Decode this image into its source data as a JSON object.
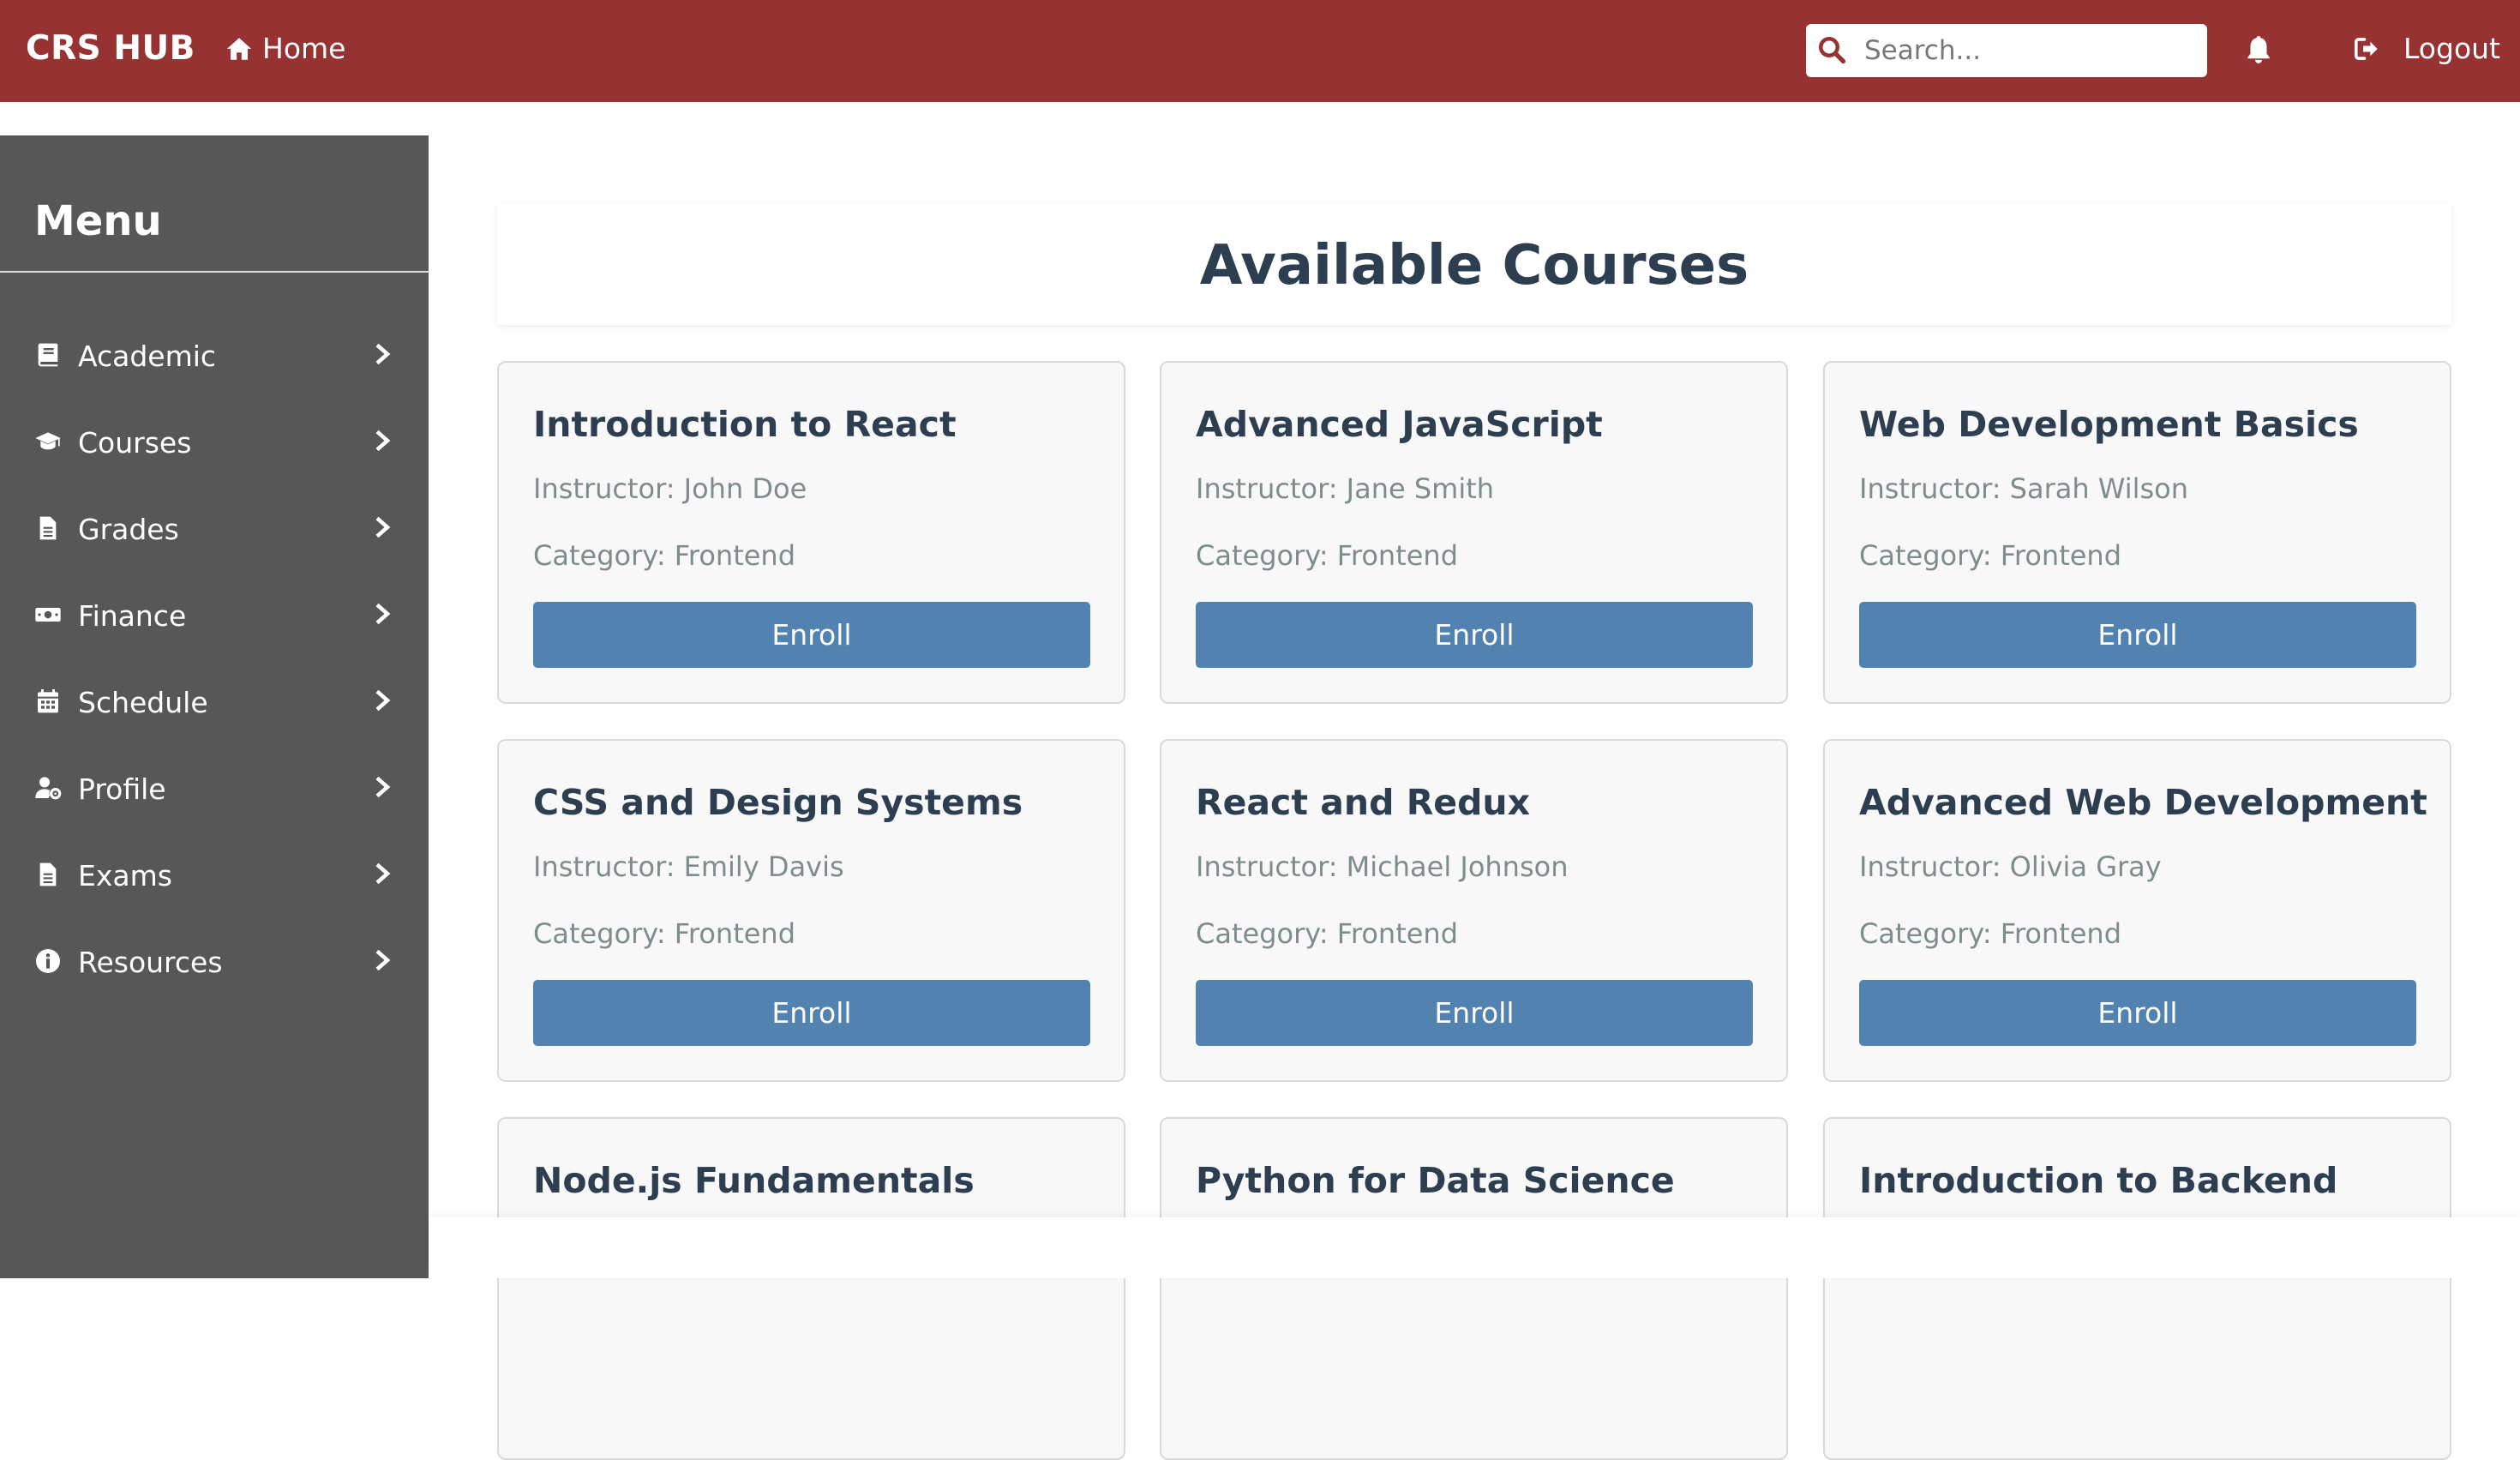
{
  "header": {
    "brand": "CRS HUB",
    "home_label": "Home",
    "search_placeholder": "Search...",
    "logout_label": "Logout"
  },
  "sidebar": {
    "title": "Menu",
    "items": [
      {
        "label": "Academic",
        "icon": "book-icon"
      },
      {
        "label": "Courses",
        "icon": "graduation-cap-icon"
      },
      {
        "label": "Grades",
        "icon": "document-icon"
      },
      {
        "label": "Finance",
        "icon": "money-icon"
      },
      {
        "label": "Schedule",
        "icon": "calendar-icon"
      },
      {
        "label": "Profile",
        "icon": "user-cog-icon"
      },
      {
        "label": "Exams",
        "icon": "document-icon"
      },
      {
        "label": "Resources",
        "icon": "info-icon"
      }
    ]
  },
  "main": {
    "title": "Available Courses",
    "enroll_label": "Enroll",
    "courses": [
      {
        "title": "Introduction to React",
        "instructor": "Instructor: John Doe",
        "category": "Category: Frontend"
      },
      {
        "title": "Advanced JavaScript",
        "instructor": "Instructor: Jane Smith",
        "category": "Category: Frontend"
      },
      {
        "title": "Web Development Basics",
        "instructor": "Instructor: Sarah Wilson",
        "category": "Category: Frontend"
      },
      {
        "title": "CSS and Design Systems",
        "instructor": "Instructor: Emily Davis",
        "category": "Category: Frontend"
      },
      {
        "title": "React and Redux",
        "instructor": "Instructor: Michael Johnson",
        "category": "Category: Frontend"
      },
      {
        "title": "Advanced Web Development",
        "instructor": "Instructor: Olivia Gray",
        "category": "Category: Frontend"
      },
      {
        "title": "Node.js Fundamentals",
        "instructor": "",
        "category": ""
      },
      {
        "title": "Python for Data Science",
        "instructor": "",
        "category": ""
      },
      {
        "title": "Introduction to Backend",
        "instructor": "",
        "category": ""
      }
    ]
  },
  "colors": {
    "header_bg": "#973232",
    "sidebar_bg": "#575757",
    "button_bg": "#5282b0",
    "heading_text": "#2c3e50"
  }
}
